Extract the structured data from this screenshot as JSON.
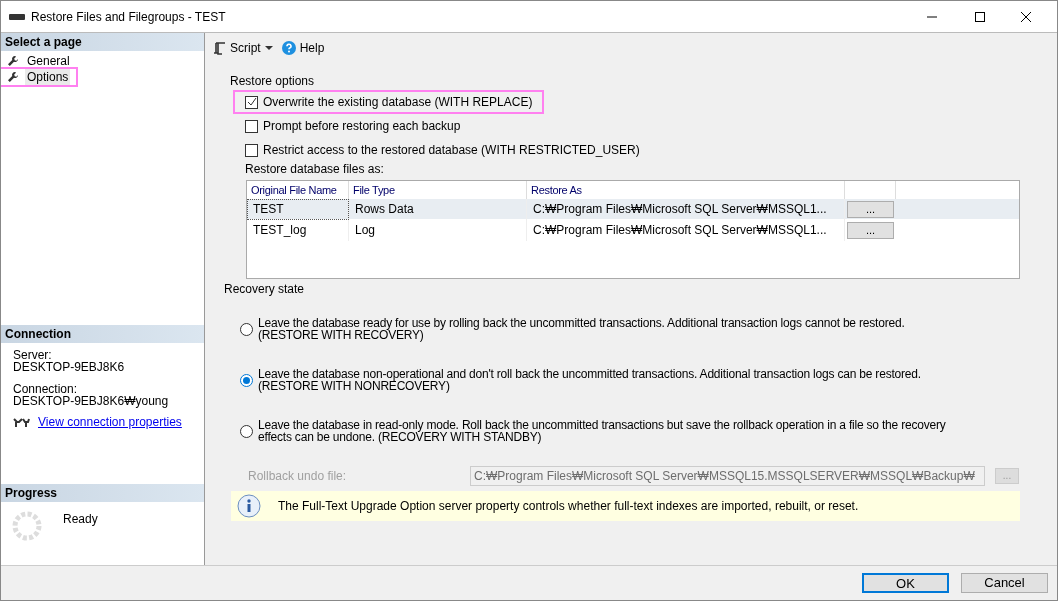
{
  "window": {
    "title": "Restore Files and Filegroups - TEST"
  },
  "sidebar": {
    "header": "Select a page",
    "items": [
      {
        "label": "General",
        "selected": false,
        "highlighted": false
      },
      {
        "label": "Options",
        "selected": true,
        "highlighted": true
      }
    ]
  },
  "connection": {
    "header": "Connection",
    "server_label": "Server:",
    "server": "DESKTOP-9EBJ8K6",
    "connection_label": "Connection:",
    "connection": "DESKTOP-9EBJ8K6₩young",
    "link": "View connection properties"
  },
  "progress": {
    "header": "Progress",
    "status": "Ready"
  },
  "toolbar": {
    "script": "Script",
    "help": "Help"
  },
  "restore_options": {
    "title": "Restore options",
    "checkboxes": [
      {
        "label": "Overwrite the existing database (WITH REPLACE)",
        "checked": true,
        "highlighted": true
      },
      {
        "label": "Prompt before restoring each backup",
        "checked": false,
        "highlighted": false
      },
      {
        "label": "Restrict access to the restored database (WITH RESTRICTED_USER)",
        "checked": false,
        "highlighted": false
      }
    ]
  },
  "files": {
    "title": "Restore database files as:",
    "columns": [
      "Original File Name",
      "File Type",
      "Restore As"
    ],
    "rows": [
      {
        "cells": [
          "TEST",
          "Rows Data",
          "C:₩Program Files₩Microsoft SQL Server₩MSSQL1..."
        ],
        "button": "...",
        "selected": true
      },
      {
        "cells": [
          "TEST_log",
          "Log",
          "C:₩Program Files₩Microsoft SQL Server₩MSSQL1..."
        ],
        "button": "...",
        "selected": false
      }
    ]
  },
  "recovery": {
    "title": "Recovery state",
    "options": [
      {
        "line1": "Leave the database ready for use by rolling back the uncommitted transactions. Additional transaction logs cannot be restored.",
        "line2": "(RESTORE WITH RECOVERY)",
        "selected": false
      },
      {
        "line1": "Leave the database non-operational and don't roll back the uncommitted transactions. Additional transaction logs can be restored.",
        "line2": "(RESTORE WITH NONRECOVERY)",
        "selected": true
      },
      {
        "line1": "Leave the database in read-only mode. Roll back the uncommitted transactions but save the rollback operation in a file so the recovery",
        "line2": "effects can be undone. (RECOVERY WITH STANDBY)",
        "selected": false
      }
    ],
    "undo_label": "Rollback undo file:",
    "undo_value": "C:₩Program Files₩Microsoft SQL Server₩MSSQL15.MSSQLSERVER₩MSSQL₩Backup₩",
    "undo_button": "...",
    "disabled": true
  },
  "info": "The Full-Text Upgrade Option server property controls whether full-text indexes are imported, rebuilt, or reset.",
  "buttons": [
    {
      "label": "OK",
      "kind": "default"
    },
    {
      "label": "Cancel",
      "kind": "normal"
    }
  ]
}
